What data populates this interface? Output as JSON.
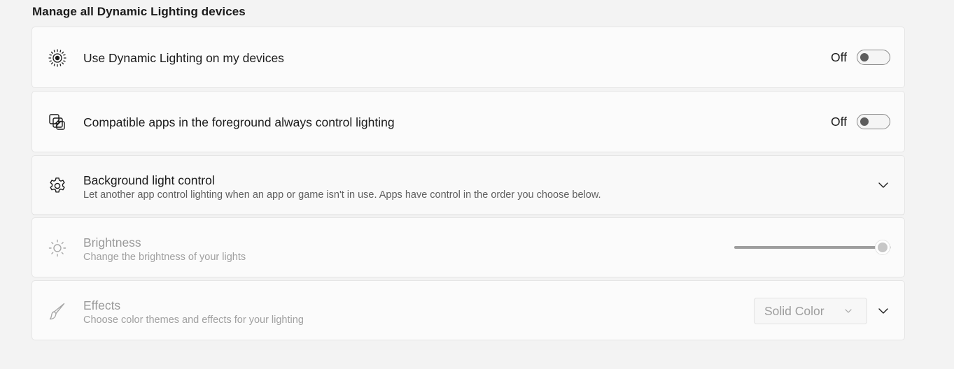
{
  "section_title": "Manage all Dynamic Lighting devices",
  "settings": {
    "dynamic_lighting": {
      "label": "Use Dynamic Lighting on my devices",
      "state_label": "Off",
      "on": false,
      "icon": "dynamic-lighting-icon"
    },
    "foreground_apps": {
      "label": "Compatible apps in the foreground always control lighting",
      "state_label": "Off",
      "on": false,
      "icon": "layers-icon"
    },
    "background_control": {
      "label": "Background light control",
      "description": "Let another app control lighting when an app or game isn't in use. Apps have control in the order you choose below.",
      "icon": "gear-icon",
      "expanded": false
    },
    "brightness": {
      "label": "Brightness",
      "description": "Change the brightness of your lights",
      "icon": "sun-icon",
      "value_fraction": 1.0,
      "enabled": false
    },
    "effects": {
      "label": "Effects",
      "description": "Choose color themes and effects for your lighting",
      "icon": "brush-icon",
      "selected": "Solid Color",
      "enabled": false
    }
  },
  "colors": {
    "background": "#f3f3f3",
    "card": "#fbfbfb",
    "text": "#1b1b1b",
    "secondary_text": "#5f5f5f",
    "disabled_text": "#9a9a9a"
  }
}
